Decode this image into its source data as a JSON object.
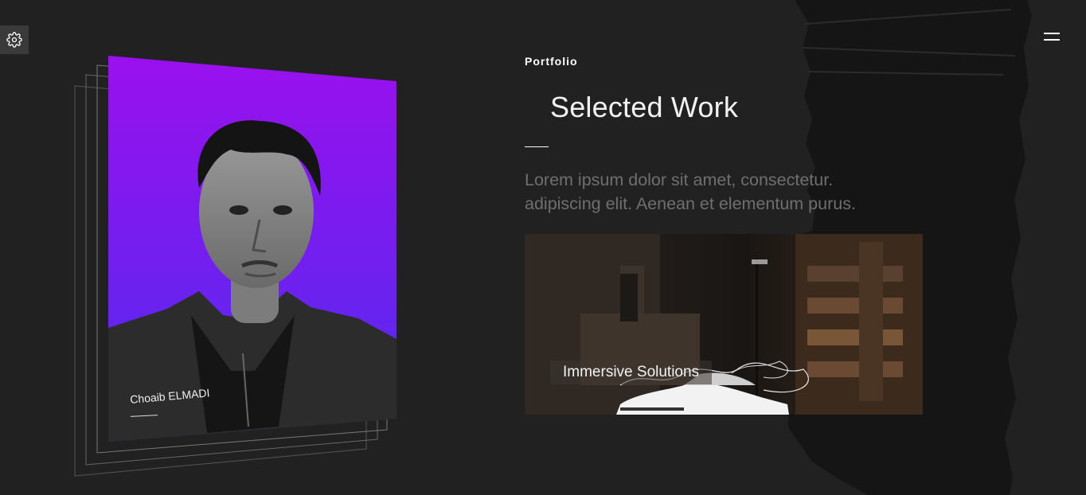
{
  "header": {
    "settings_icon": "gear-icon",
    "menu_icon": "hamburger-menu-icon"
  },
  "hero": {
    "caption_name": "Choaib ELMADI",
    "gradient_top": "#9a10ee",
    "gradient_bottom": "#4f2cf0"
  },
  "section": {
    "eyebrow": "Portfolio",
    "title": "Selected Work",
    "description": "Lorem ipsum dolor sit amet, consectetur. adipiscing elit. Aenean et elementum purus."
  },
  "projects": [
    {
      "title": "Immersive Solutions"
    }
  ]
}
